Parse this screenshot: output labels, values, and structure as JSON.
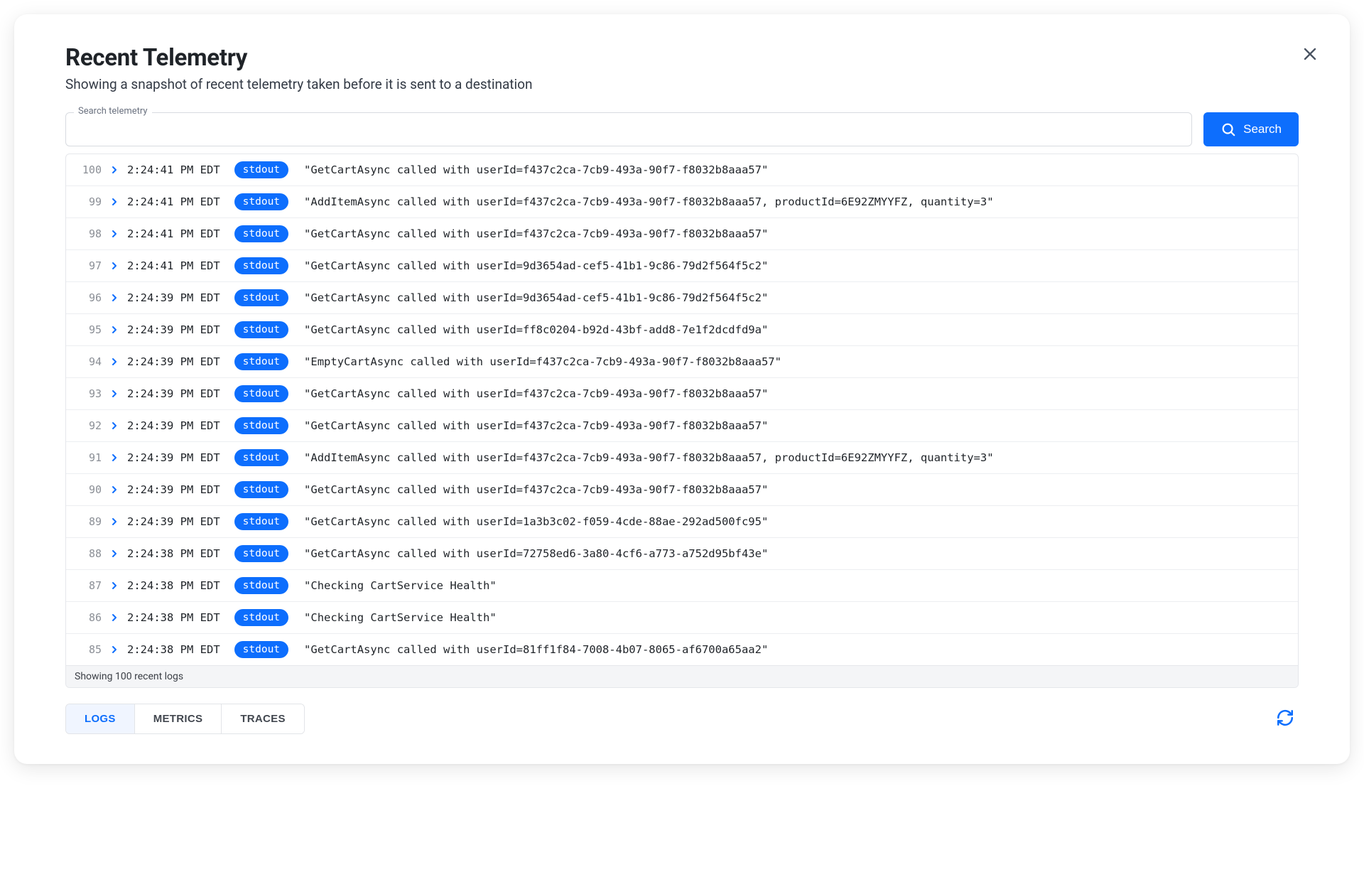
{
  "header": {
    "title": "Recent Telemetry",
    "subtitle": "Showing a snapshot of recent telemetry taken before it is sent to a destination"
  },
  "search": {
    "legend": "Search telemetry",
    "value": "",
    "button_label": "Search"
  },
  "logs": [
    {
      "idx": "100",
      "time": "2:24:41 PM EDT",
      "stream": "stdout",
      "msg": "\"GetCartAsync called with userId=f437c2ca-7cb9-493a-90f7-f8032b8aaa57\""
    },
    {
      "idx": "99",
      "time": "2:24:41 PM EDT",
      "stream": "stdout",
      "msg": "\"AddItemAsync called with userId=f437c2ca-7cb9-493a-90f7-f8032b8aaa57, productId=6E92ZMYYFZ, quantity=3\""
    },
    {
      "idx": "98",
      "time": "2:24:41 PM EDT",
      "stream": "stdout",
      "msg": "\"GetCartAsync called with userId=f437c2ca-7cb9-493a-90f7-f8032b8aaa57\""
    },
    {
      "idx": "97",
      "time": "2:24:41 PM EDT",
      "stream": "stdout",
      "msg": "\"GetCartAsync called with userId=9d3654ad-cef5-41b1-9c86-79d2f564f5c2\""
    },
    {
      "idx": "96",
      "time": "2:24:39 PM EDT",
      "stream": "stdout",
      "msg": "\"GetCartAsync called with userId=9d3654ad-cef5-41b1-9c86-79d2f564f5c2\""
    },
    {
      "idx": "95",
      "time": "2:24:39 PM EDT",
      "stream": "stdout",
      "msg": "\"GetCartAsync called with userId=ff8c0204-b92d-43bf-add8-7e1f2dcdfd9a\""
    },
    {
      "idx": "94",
      "time": "2:24:39 PM EDT",
      "stream": "stdout",
      "msg": "\"EmptyCartAsync called with userId=f437c2ca-7cb9-493a-90f7-f8032b8aaa57\""
    },
    {
      "idx": "93",
      "time": "2:24:39 PM EDT",
      "stream": "stdout",
      "msg": "\"GetCartAsync called with userId=f437c2ca-7cb9-493a-90f7-f8032b8aaa57\""
    },
    {
      "idx": "92",
      "time": "2:24:39 PM EDT",
      "stream": "stdout",
      "msg": "\"GetCartAsync called with userId=f437c2ca-7cb9-493a-90f7-f8032b8aaa57\""
    },
    {
      "idx": "91",
      "time": "2:24:39 PM EDT",
      "stream": "stdout",
      "msg": "\"AddItemAsync called with userId=f437c2ca-7cb9-493a-90f7-f8032b8aaa57, productId=6E92ZMYYFZ, quantity=3\""
    },
    {
      "idx": "90",
      "time": "2:24:39 PM EDT",
      "stream": "stdout",
      "msg": "\"GetCartAsync called with userId=f437c2ca-7cb9-493a-90f7-f8032b8aaa57\""
    },
    {
      "idx": "89",
      "time": "2:24:39 PM EDT",
      "stream": "stdout",
      "msg": "\"GetCartAsync called with userId=1a3b3c02-f059-4cde-88ae-292ad500fc95\""
    },
    {
      "idx": "88",
      "time": "2:24:38 PM EDT",
      "stream": "stdout",
      "msg": "\"GetCartAsync called with userId=72758ed6-3a80-4cf6-a773-a752d95bf43e\""
    },
    {
      "idx": "87",
      "time": "2:24:38 PM EDT",
      "stream": "stdout",
      "msg": "\"Checking CartService Health\""
    },
    {
      "idx": "86",
      "time": "2:24:38 PM EDT",
      "stream": "stdout",
      "msg": "\"Checking CartService Health\""
    },
    {
      "idx": "85",
      "time": "2:24:38 PM EDT",
      "stream": "stdout",
      "msg": "\"GetCartAsync called with userId=81ff1f84-7008-4b07-8065-af6700a65aa2\""
    }
  ],
  "footer": {
    "count_text": "Showing 100 recent logs"
  },
  "tabs": {
    "logs": "LOGS",
    "metrics": "METRICS",
    "traces": "TRACES",
    "active": "logs"
  }
}
